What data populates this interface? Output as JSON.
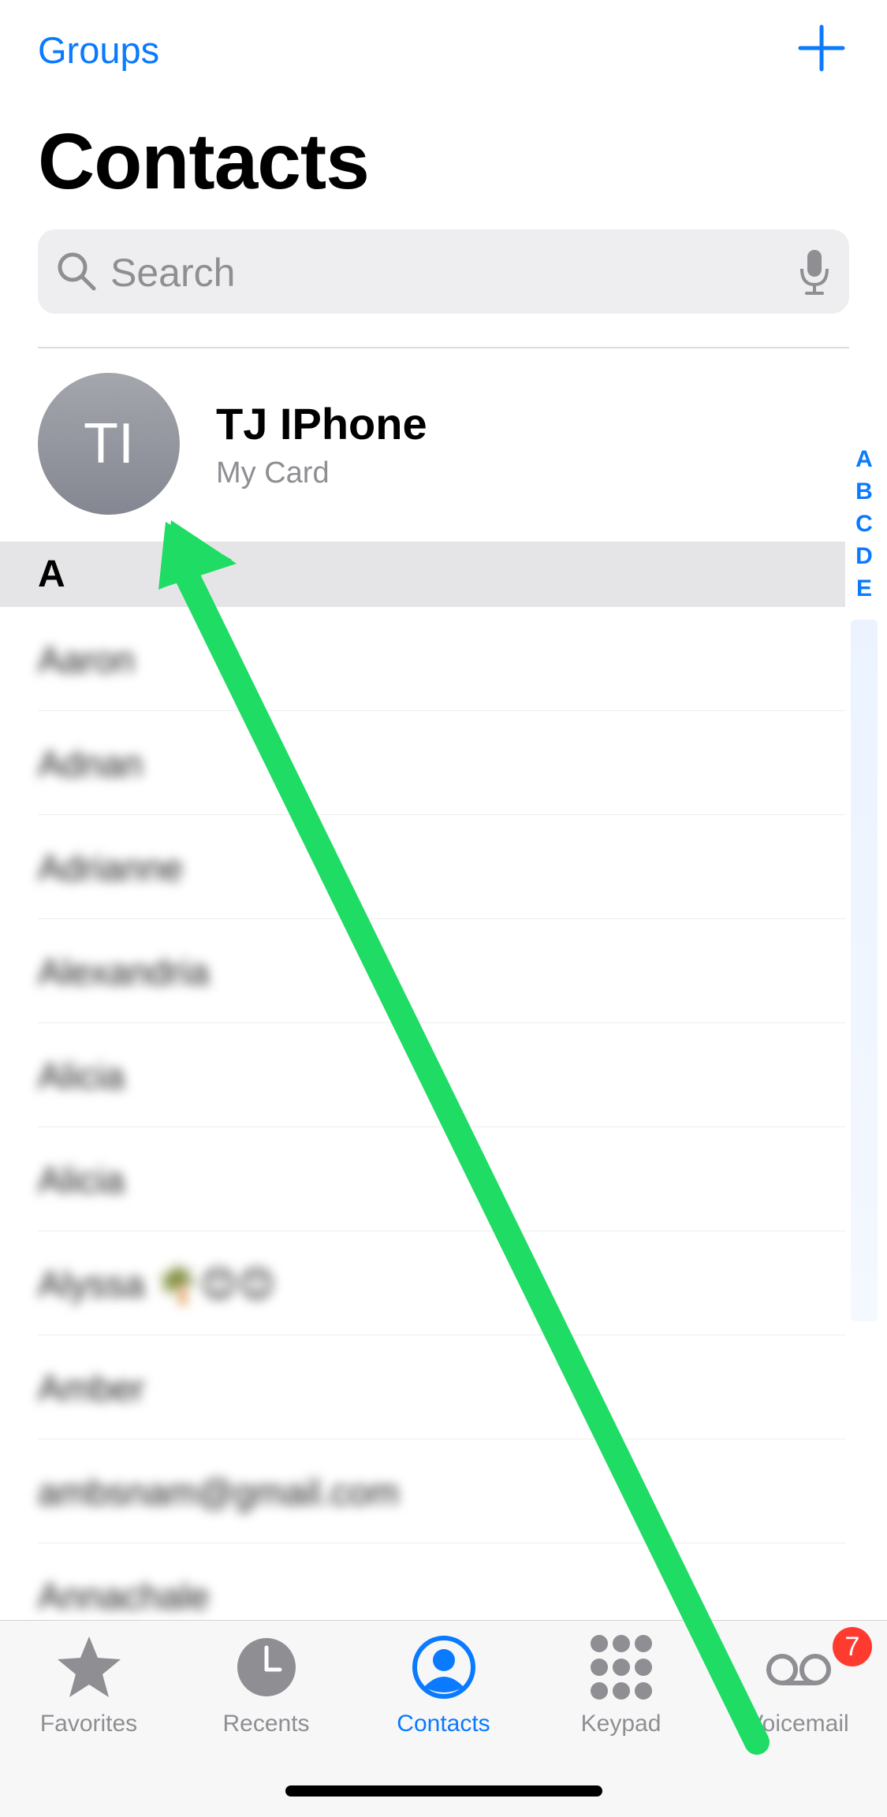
{
  "header": {
    "groups_label": "Groups",
    "add_icon": "plus-icon",
    "title": "Contacts"
  },
  "search": {
    "placeholder": "Search",
    "search_icon": "magnifier-icon",
    "mic_icon": "microphone-icon"
  },
  "my_card": {
    "initials": "TI",
    "name": "TJ IPhone",
    "subtitle": "My Card"
  },
  "index_letters": [
    "A",
    "B",
    "C",
    "D",
    "E"
  ],
  "section": {
    "letter": "A"
  },
  "contacts": [
    {
      "name": "Aaron"
    },
    {
      "name": "Adnan"
    },
    {
      "name": "Adrianne"
    },
    {
      "name": "Alexandria"
    },
    {
      "name": "Alicia"
    },
    {
      "name": "Alicia"
    },
    {
      "name": "Alyssa 🌴😊😊"
    },
    {
      "name": "Amber"
    },
    {
      "name": "ambsnam@gmail.com"
    },
    {
      "name": "Annachale"
    }
  ],
  "tabs": [
    {
      "label": "Favorites",
      "icon": "star-icon",
      "active": false
    },
    {
      "label": "Recents",
      "icon": "clock-icon",
      "active": false
    },
    {
      "label": "Contacts",
      "icon": "person-circle-icon",
      "active": true
    },
    {
      "label": "Keypad",
      "icon": "keypad-icon",
      "active": false
    },
    {
      "label": "Voicemail",
      "icon": "voicemail-icon",
      "active": false
    }
  ],
  "voicemail_badge": "7",
  "colors": {
    "accent": "#0a7aff",
    "annotation_arrow": "#1edc64",
    "badge": "#ff3b30"
  }
}
